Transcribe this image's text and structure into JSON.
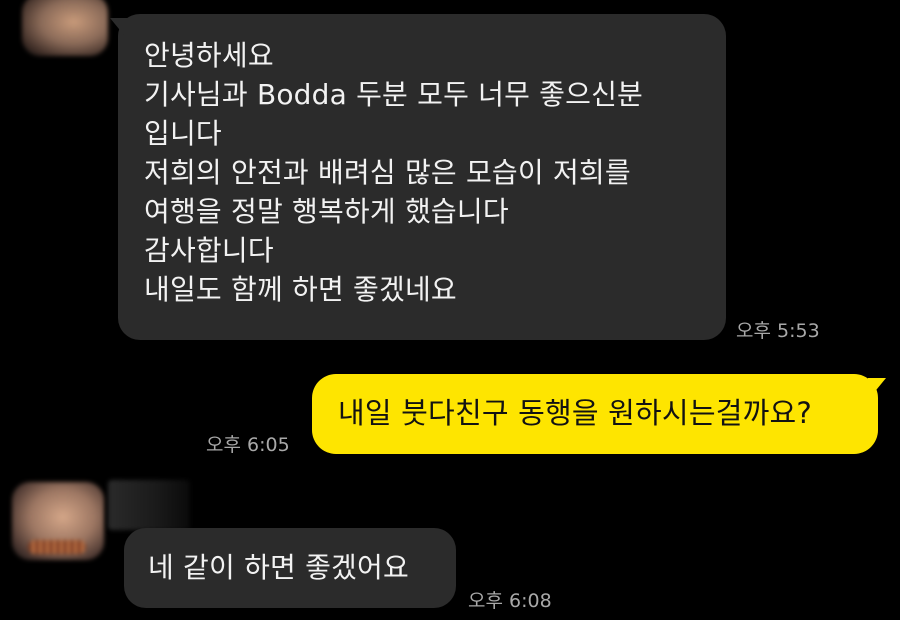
{
  "messages": [
    {
      "side": "incoming",
      "lines": [
        "안녕하세요",
        "기사님과 Bodda 두분 모두 너무 좋으신분",
        "입니다",
        "저희의 안전과 배려심 많은 모습이 저희를",
        "여행을 정말 행복하게 했습니다",
        "감사합니다",
        "내일도 함께 하면 좋겠네요"
      ],
      "time": "오후 5:53"
    },
    {
      "side": "outgoing",
      "text": "내일 붓다친구 동행을 원하시는걸까요?",
      "time": "오후 6:05"
    },
    {
      "side": "incoming",
      "text": "네 같이 하면 좋겠어요",
      "time": "오후 6:08"
    }
  ],
  "colors": {
    "background": "#000000",
    "incoming_bubble": "#2b2b2b",
    "outgoing_bubble": "#fee500",
    "timestamp": "#a8a8a8"
  }
}
